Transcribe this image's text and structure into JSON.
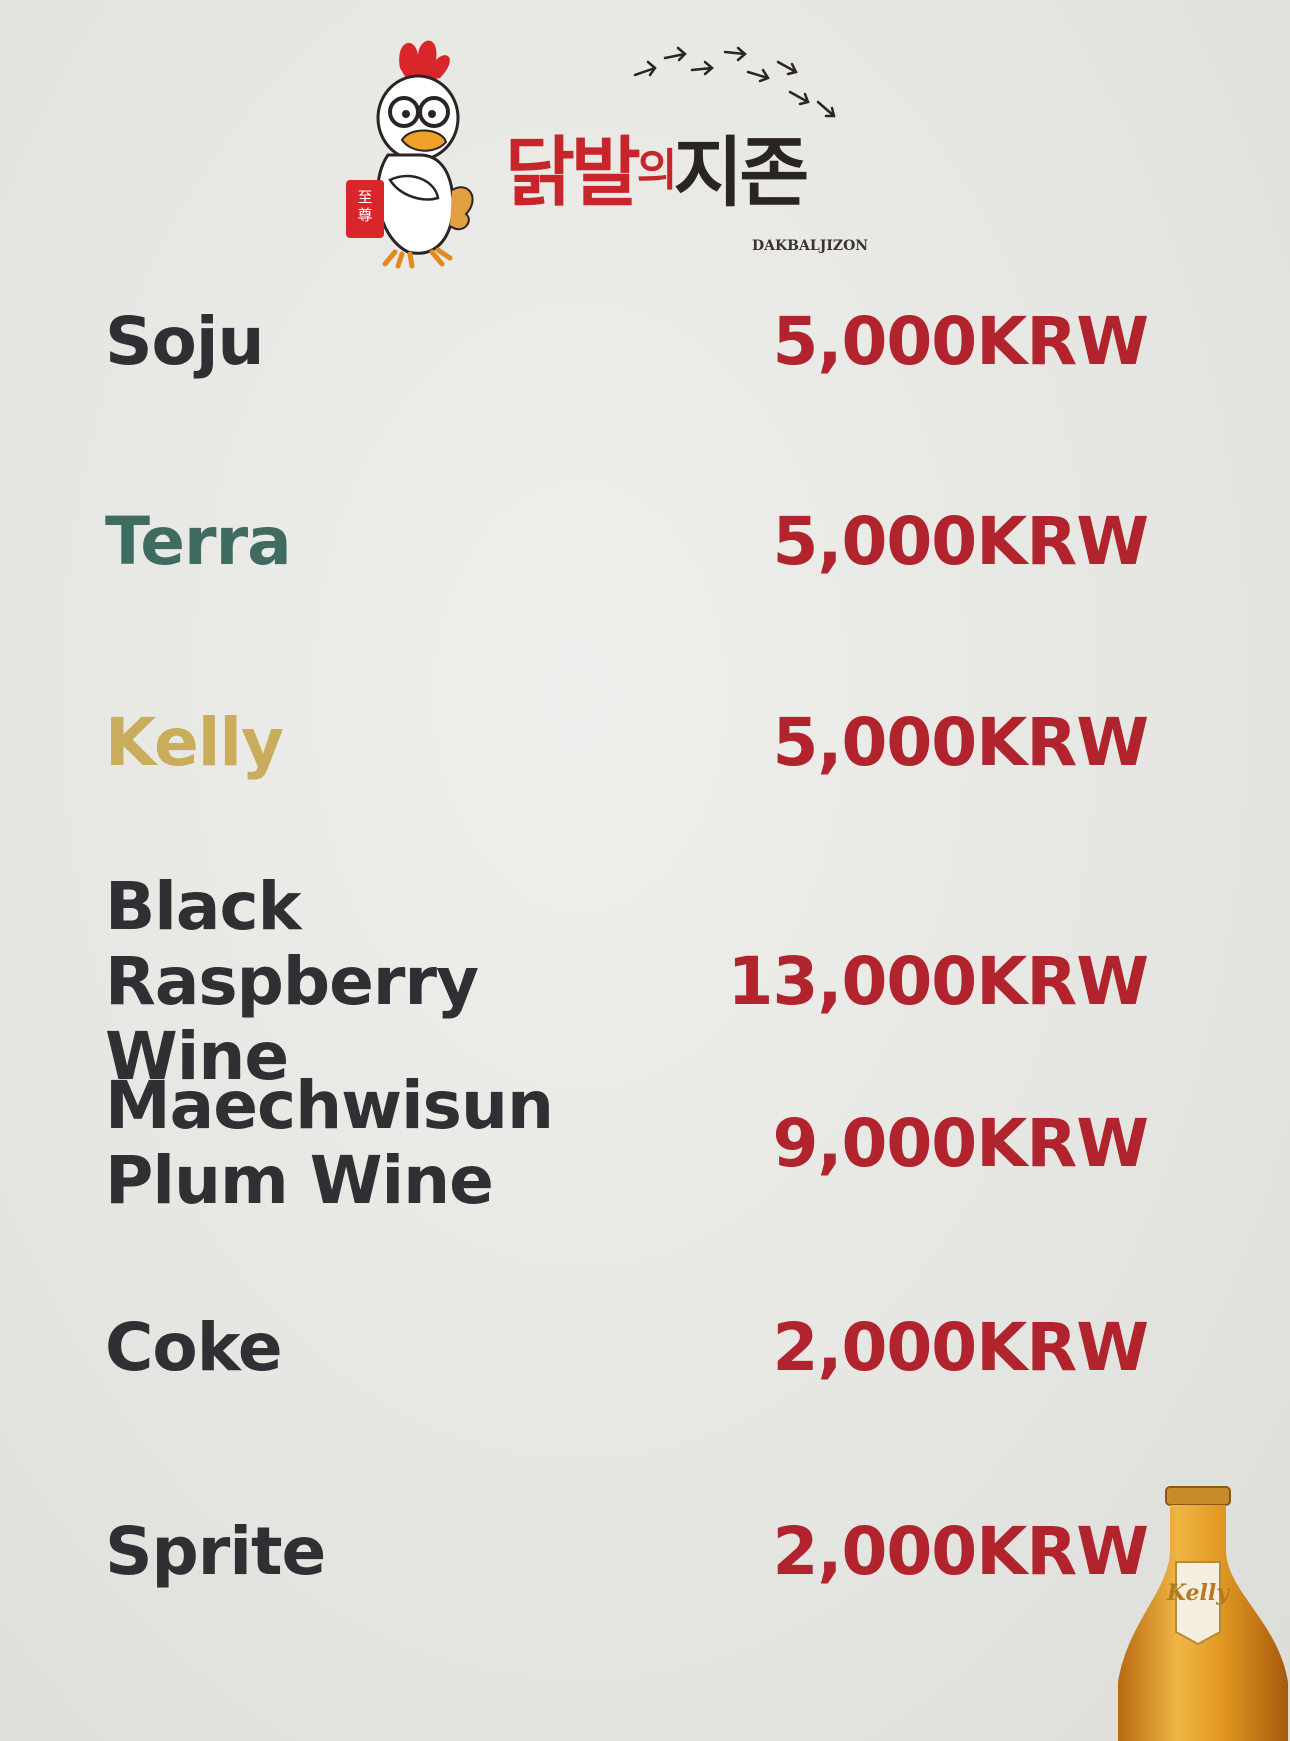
{
  "brand": {
    "name_part1": "닭발",
    "name_part2": "의",
    "name_part3": "지존",
    "romanized": "DAKBALJIZON",
    "seal_text": "至尊"
  },
  "colors": {
    "background": "#e8e8e5",
    "price": "#b1232d",
    "default_item": "#2f3033",
    "terra": "#3f6b61",
    "kelly": "#c9ac5c",
    "logo_red": "#c8252b"
  },
  "icons": [
    "rooster-mascot-icon",
    "bird-footprints-icon",
    "kelly-beer-bottle-icon"
  ],
  "menu": {
    "items": [
      {
        "name": "Soju",
        "price": "5,000KRW"
      },
      {
        "name": "Terra",
        "price": "5,000KRW"
      },
      {
        "name": "Kelly",
        "price": "5,000KRW"
      },
      {
        "name": "Black Raspberry\nWine",
        "price": "13,000KRW"
      },
      {
        "name": "Maechwisun\nPlum Wine",
        "price": "9,000KRW"
      },
      {
        "name": "Coke",
        "price": "2,000KRW"
      },
      {
        "name": "Sprite",
        "price": "2,000KRW"
      }
    ]
  },
  "bottle": {
    "label": "Kelly"
  }
}
